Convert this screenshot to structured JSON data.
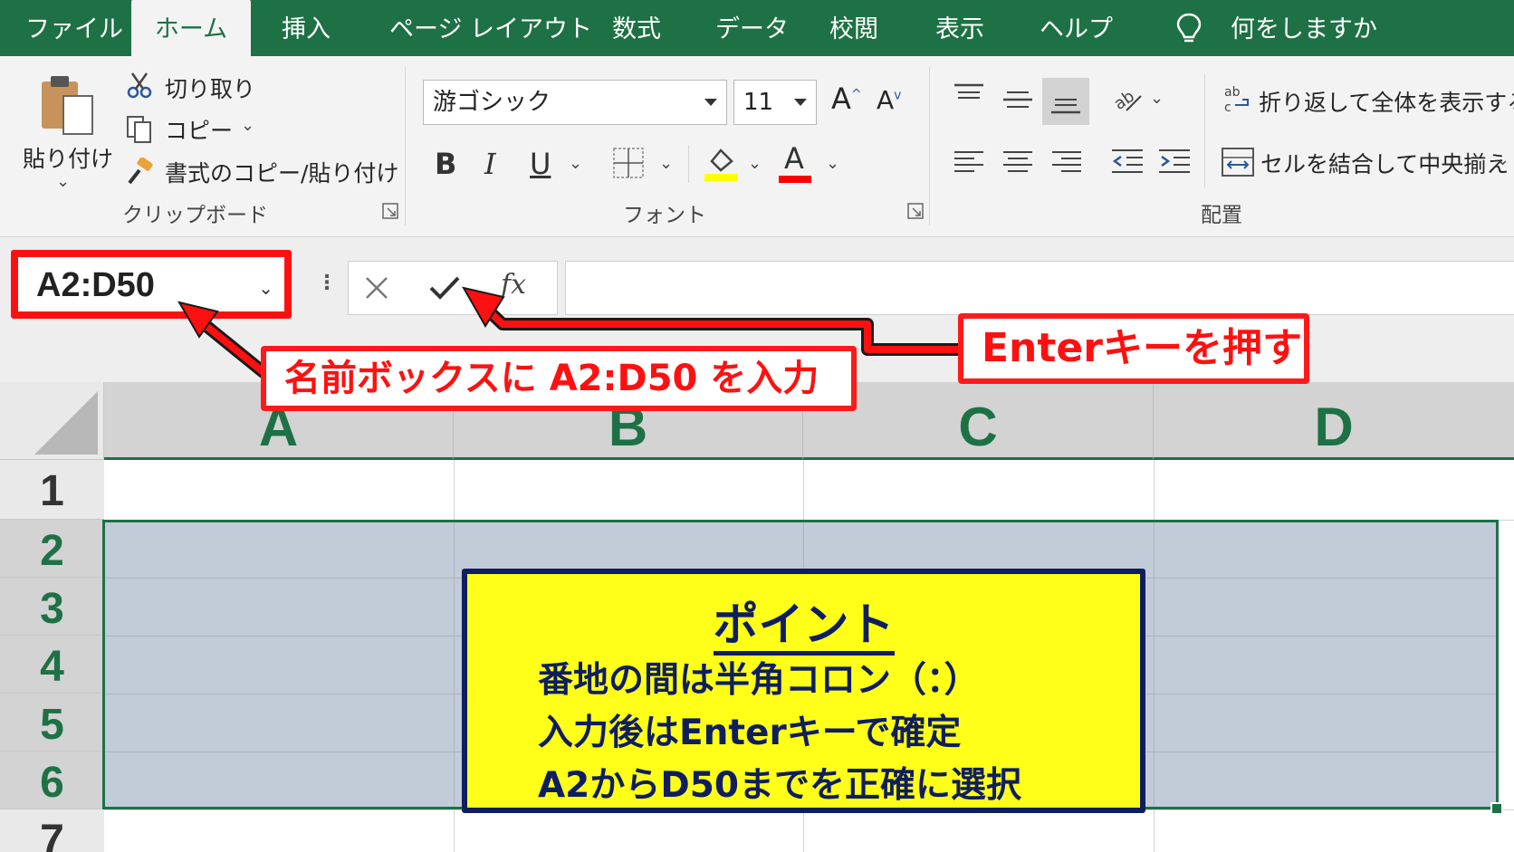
{
  "tabs": {
    "file": "ファイル",
    "home": "ホーム",
    "insert": "挿入",
    "page_layout": "ページ レイアウト",
    "formulas": "数式",
    "data": "データ",
    "review": "校閲",
    "view": "表示",
    "help": "ヘルプ",
    "tell_me": "何をしますか"
  },
  "clipboard": {
    "paste": "貼り付け",
    "cut": "切り取り",
    "copy": "コピー",
    "format_painter": "書式のコピー/貼り付け",
    "group_label": "クリップボード"
  },
  "font": {
    "name": "游ゴシック",
    "size": "11",
    "bold": "B",
    "italic": "I",
    "underline": "U",
    "font_color_letter": "A",
    "highlight_color": "#ffff00",
    "font_color": "#ff0000",
    "group_label": "フォント"
  },
  "alignment": {
    "wrap_text": "折り返して全体を表示する",
    "merge_center": "セルを結合して中央揃え",
    "group_label": "配置"
  },
  "formula_bar": {
    "name_box": "A2:D50",
    "fx": "fx"
  },
  "sheet": {
    "columns": [
      "A",
      "B",
      "C",
      "D"
    ],
    "rows": [
      "1",
      "2",
      "3",
      "4",
      "5",
      "6",
      "7"
    ],
    "selected_range": "A2:D50"
  },
  "callouts": {
    "name_box_hint": "名前ボックスに  A2:D50 を入力",
    "enter_hint": "Enterキーを押す",
    "point_title": "ポイント",
    "point_lines": [
      "番地の間は半角コロン（：）",
      "入力後はEnterキーで確定",
      "A2からD50までを正確に選択"
    ]
  },
  "colors": {
    "excel_green": "#1e7145",
    "callout_red": "#ff1010",
    "point_yellow": "#ffff1a",
    "point_navy": "#0f1e5e",
    "selection_fill": "#c2cbd8"
  }
}
